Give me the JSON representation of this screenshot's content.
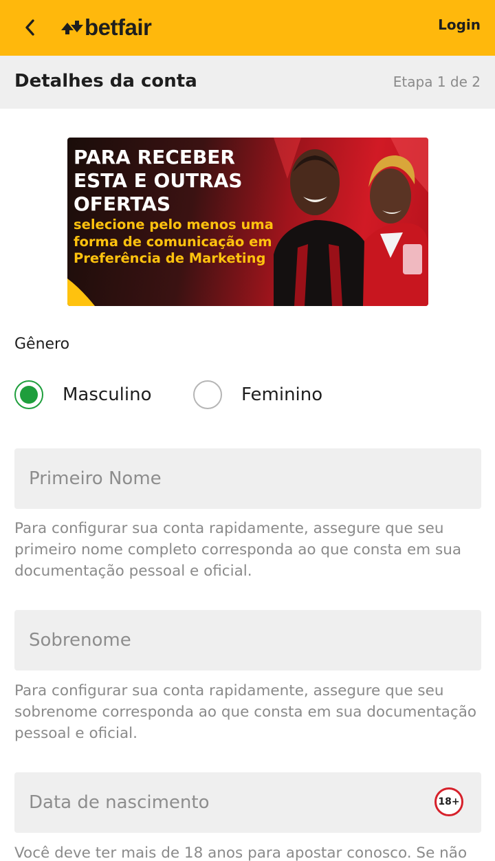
{
  "header": {
    "brand": "betfair",
    "login_label": "Login",
    "back_icon": "chevron-left-icon",
    "logo_icon": "betfair-arrows-icon",
    "background_color": "#ffb80c"
  },
  "step": {
    "title": "Detalhes da conta",
    "indicator": "Etapa 1 de 2"
  },
  "banner": {
    "headline": [
      "PARA RECEBER",
      "ESTA E OUTRAS",
      "OFERTAS"
    ],
    "subline": [
      "selecione pelo menos uma",
      "forma de comunicação em",
      "Preferência de Marketing"
    ]
  },
  "gender": {
    "label": "Gênero",
    "options": [
      {
        "label": "Masculino",
        "selected": true
      },
      {
        "label": "Feminino",
        "selected": false
      }
    ],
    "accent_color": "#1e9e3c"
  },
  "fields": {
    "first_name": {
      "placeholder": "Primeiro Nome",
      "value": "",
      "hint": "Para configurar sua conta rapidamente, assegure que seu primeiro nome completo corresponda ao que consta em sua documentação pessoal e oficial."
    },
    "last_name": {
      "placeholder": "Sobrenome",
      "value": "",
      "hint": "Para configurar sua conta rapidamente, assegure que seu sobrenome corresponda ao que consta em sua documentação pessoal e oficial."
    },
    "birth_date": {
      "placeholder": "Data de nascimento",
      "value": "",
      "badge": "18+",
      "hint": "Você deve ter mais de 18 anos para apostar conosco. Se não"
    }
  }
}
